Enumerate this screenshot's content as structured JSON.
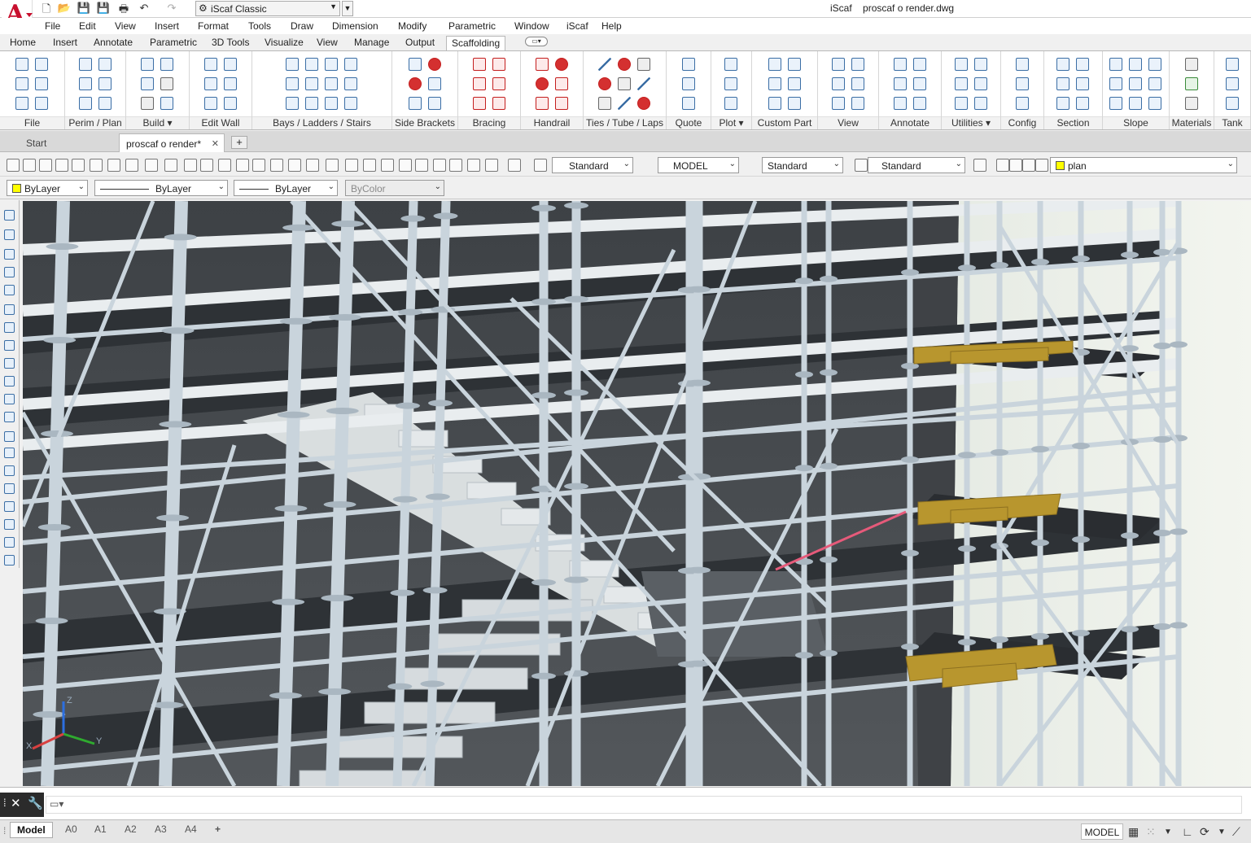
{
  "app": {
    "workspace": "iScaf Classic",
    "title_app": "iScaf",
    "title_file": "proscaf o render.dwg"
  },
  "menu": [
    "File",
    "Edit",
    "View",
    "Insert",
    "Format",
    "Tools",
    "Draw",
    "Dimension",
    "Modify",
    "Parametric",
    "Window",
    "iScaf",
    "Help"
  ],
  "ribbon_tabs": [
    "Home",
    "Insert",
    "Annotate",
    "Parametric",
    "3D Tools",
    "Visualize",
    "View",
    "Manage",
    "Output",
    "Scaffolding"
  ],
  "active_ribbon_tab": "Scaffolding",
  "ribbon_panels": [
    {
      "label": "File"
    },
    {
      "label": "Perim / Plan"
    },
    {
      "label": "Build ▾"
    },
    {
      "label": "Edit Wall"
    },
    {
      "label": "Bays /  Ladders / Stairs"
    },
    {
      "label": "Side Brackets"
    },
    {
      "label": "Bracing"
    },
    {
      "label": "Handrail"
    },
    {
      "label": "Ties / Tube / Laps"
    },
    {
      "label": "Quote"
    },
    {
      "label": "Plot ▾"
    },
    {
      "label": "Custom Part"
    },
    {
      "label": "View"
    },
    {
      "label": "Annotate"
    },
    {
      "label": "Utilities ▾"
    },
    {
      "label": "Config"
    },
    {
      "label": "Section"
    },
    {
      "label": "Slope"
    },
    {
      "label": "Materials"
    },
    {
      "label": "Tank"
    }
  ],
  "doc_tabs": [
    {
      "label": "Start"
    },
    {
      "label": "proscaf o render*",
      "close": "✕"
    }
  ],
  "tab_add": "+",
  "toolbar1": {
    "text_style": "Standard",
    "dim_style": "MODEL",
    "table_style": "Standard",
    "mleader_style": "Standard",
    "layer": "plan"
  },
  "toolbar2": {
    "color": "ByLayer",
    "linetype": "ByLayer",
    "lineweight": "ByLayer",
    "plotstyle": "ByColor"
  },
  "ucs": {
    "x": "X",
    "y": "Y",
    "z": "Z"
  },
  "layout_tabs": [
    "Model",
    "A0",
    "A1",
    "A2",
    "A3",
    "A4"
  ],
  "layout_add": "+",
  "status": {
    "model": "MODEL"
  },
  "colors": {
    "brand_red": "#c8102e",
    "ribbon_blue": "#3b6ea5",
    "layer_yellow": "#ffff00",
    "scaffold_tube": "#c9d4dc",
    "plank_yellow": "#b8962e"
  }
}
